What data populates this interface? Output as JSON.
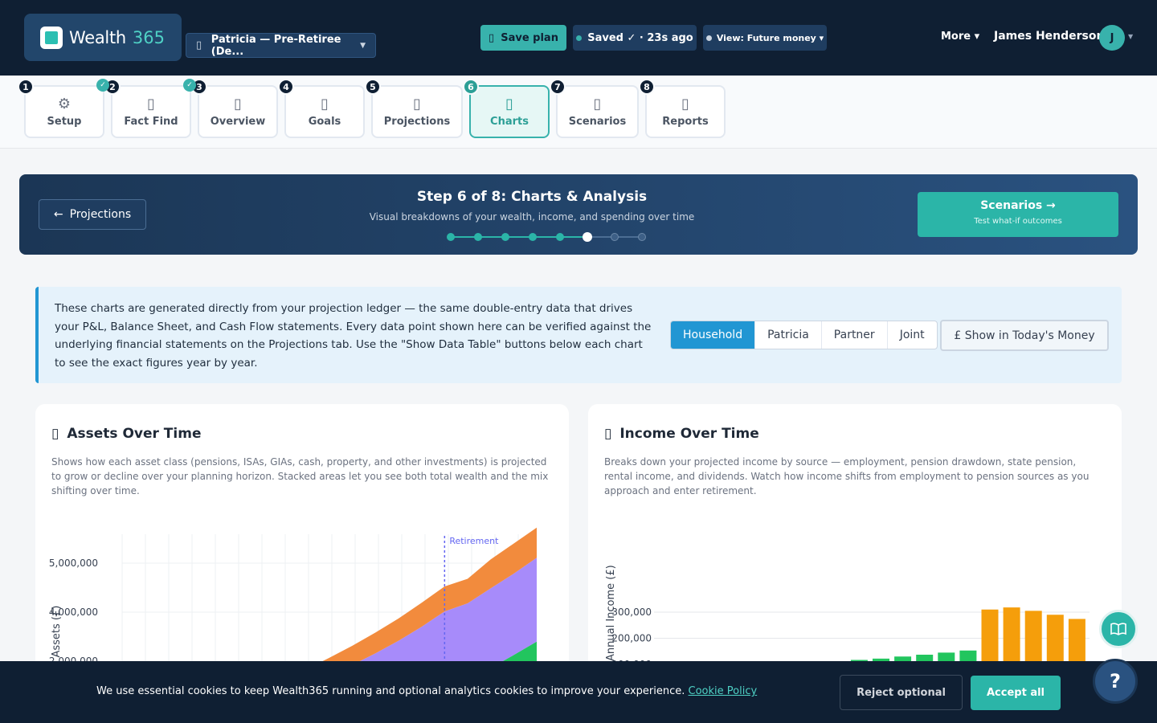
{
  "app": {
    "name": "Wealth",
    "name_num": "365"
  },
  "header": {
    "client": "Patricia — Pre-Retiree (De...",
    "save_label": "Save plan",
    "saved_label": "Saved ✓ · 23s ago",
    "view_label": "View: Future money ▾",
    "more_label": "More ▾",
    "user_name": "James Henderson",
    "avatar_initial": "J"
  },
  "steps": [
    {
      "num": "1",
      "label": "Setup",
      "icon": "gear-icon",
      "glyph": "⚙",
      "done": false
    },
    {
      "num": "2",
      "label": "Fact Find",
      "icon": "fact-find-icon",
      "glyph": "▯",
      "done": true
    },
    {
      "num": "3",
      "label": "Overview",
      "icon": "overview-icon",
      "glyph": "▯",
      "done": true
    },
    {
      "num": "4",
      "label": "Goals",
      "icon": "goals-icon",
      "glyph": "▯",
      "done": false
    },
    {
      "num": "5",
      "label": "Projections",
      "icon": "projections-icon",
      "glyph": "▯",
      "done": false
    },
    {
      "num": "6",
      "label": "Charts",
      "icon": "charts-icon",
      "glyph": "▯",
      "done": false,
      "active": true
    },
    {
      "num": "7",
      "label": "Scenarios",
      "icon": "scenarios-icon",
      "glyph": "▯",
      "done": false
    },
    {
      "num": "8",
      "label": "Reports",
      "icon": "reports-icon",
      "glyph": "▯",
      "done": false
    }
  ],
  "banner": {
    "back_label": "Projections",
    "title": "Step 6 of 8: Charts & Analysis",
    "subtitle": "Visual breakdowns of your wealth, income, and spending over time",
    "next_label": "Scenarios →",
    "next_sub": "Test what-if outcomes",
    "current_step": 6,
    "total_steps": 8
  },
  "info": {
    "text": "These charts are generated directly from your projection ledger — the same double-entry data that drives your P&L, Balance Sheet, and Cash Flow statements. Every data point shown here can be verified against the underlying financial statements on the Projections tab. Use the \"Show Data Table\" buttons below each chart to see the exact figures year by year.",
    "segments": [
      "Household",
      "Patricia",
      "Partner",
      "Joint"
    ],
    "selected_segment": "Household",
    "today_money_label": "£ Show in Today's Money"
  },
  "cards": {
    "assets": {
      "title": "Assets Over Time",
      "desc": "Shows how each asset class (pensions, ISAs, GIAs, cash, property, and other investments) is projected to grow or decline over your planning horizon. Stacked areas let you see both total wealth and the mix shifting over time."
    },
    "income": {
      "title": "Income Over Time",
      "desc": "Breaks down your projected income by source — employment, pension drawdown, state pension, rental income, and dividends. Watch how income shifts from employment to pension sources as you approach and enter retirement."
    }
  },
  "chart_data": [
    {
      "type": "area",
      "ylabel": "Total Assets (£)",
      "ytick_labels": [
        "2,000,000",
        "4,000,000",
        "5,000,000"
      ],
      "yticks": [
        2000000,
        4000000,
        5000000
      ],
      "annotation": "Retirement",
      "retirement_index": 14,
      "series": [
        {
          "color": "#22c55e",
          "values": [
            0,
            0,
            0,
            0,
            0,
            0,
            0,
            0,
            0,
            0,
            0,
            0,
            0,
            0,
            0,
            260000,
            820000,
            1350000,
            1900000
          ]
        },
        {
          "color": "#a78bfa",
          "values": [
            0,
            0,
            0,
            0,
            0,
            0,
            0,
            0,
            120000,
            520000,
            950000,
            1420000,
            1930000,
            2500000,
            3130000,
            3200000,
            3250000,
            3320000,
            3420000
          ]
        },
        {
          "color": "#f28b3d",
          "values": [
            0,
            0,
            0,
            0,
            0,
            0,
            0,
            0,
            650000,
            720000,
            780000,
            850000,
            910000,
            980000,
            1020000,
            1000000,
            1180000,
            1230000,
            1230000
          ]
        }
      ]
    },
    {
      "type": "bar",
      "ylabel": "Annual Income (£)",
      "ytick_labels": [
        "100,000",
        "200,000",
        "300,000"
      ],
      "yticks": [
        100000,
        200000,
        300000
      ],
      "series": [
        {
          "color": "#22c55e",
          "values": [
            76000,
            78000,
            82000,
            86000,
            90000,
            95000,
            100000,
            104000,
            110000,
            117000,
            122000,
            130000,
            137000,
            145000,
            153000
          ]
        },
        {
          "color": "#f59e0b",
          "values": [
            310000,
            318000,
            305000,
            290000,
            274000
          ]
        }
      ]
    }
  ],
  "cookie": {
    "text": "We use essential cookies to keep Wealth365 running and optional analytics cookies to improve your experience.",
    "link": "Cookie Policy",
    "reject": "Reject optional",
    "accept": "Accept all"
  },
  "colors": {
    "accent": "#2bb5a8",
    "navy": "#0f1f33",
    "info_blue": "#2196d3"
  }
}
